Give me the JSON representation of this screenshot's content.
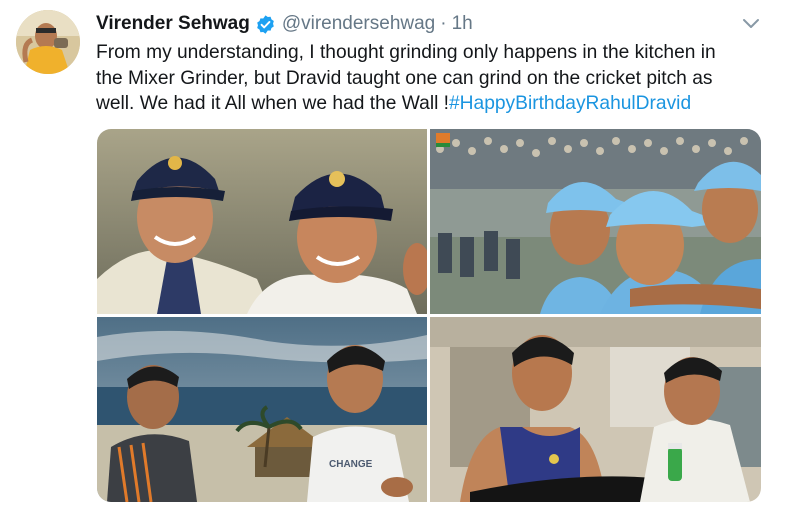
{
  "tweet": {
    "display_name": "Virender Sehwag",
    "handle": "@virendersehwag",
    "separator": "·",
    "time": "1h",
    "text_lines": [
      "From my understanding, I thought grinding only happens in the kitchen in",
      "the Mixer Grinder, but Dravid taught one can grind on the cricket pitch as",
      "well. We had it All when we had the Wall !"
    ],
    "hashtag": "#HappyBirthdayRahulDravid"
  },
  "colors": {
    "text": "#14171a",
    "secondary": "#657786",
    "link": "#1b95e0",
    "verified": "#1da1f2"
  },
  "icons": {
    "verified": "verified-badge-icon",
    "caret": "chevron-down-icon"
  }
}
